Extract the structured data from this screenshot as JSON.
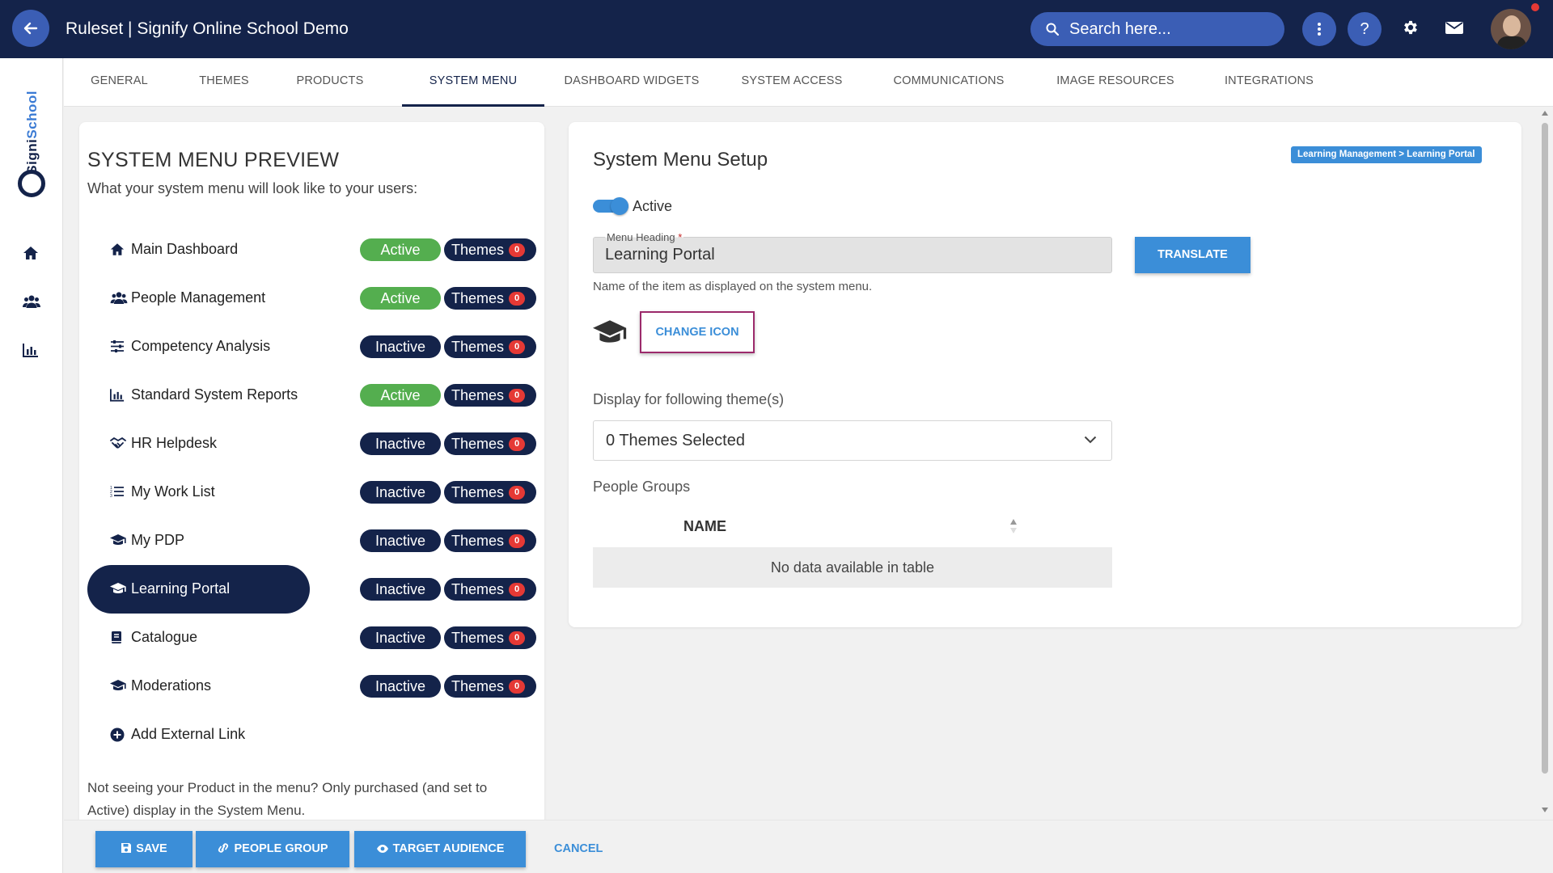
{
  "header": {
    "title": "Ruleset | Signify Online School Demo",
    "search_placeholder": "Search here..."
  },
  "rail": {
    "logo_part1": "Signi",
    "logo_part2": "School"
  },
  "tabs": [
    {
      "label": "GENERAL"
    },
    {
      "label": "THEMES"
    },
    {
      "label": "PRODUCTS"
    },
    {
      "label": "SYSTEM MENU",
      "active": true
    },
    {
      "label": "DASHBOARD WIDGETS"
    },
    {
      "label": "SYSTEM ACCESS"
    },
    {
      "label": "COMMUNICATIONS"
    },
    {
      "label": "IMAGE RESOURCES"
    },
    {
      "label": "INTEGRATIONS"
    }
  ],
  "preview": {
    "title": "SYSTEM MENU PREVIEW",
    "subtitle": "What your system menu will look like to your users:",
    "items": [
      {
        "label": "Main Dashboard",
        "icon": "home-icon",
        "status": "Active",
        "themes_label": "Themes",
        "themes_count": "0"
      },
      {
        "label": "People Management",
        "icon": "users-icon",
        "status": "Active",
        "themes_label": "Themes",
        "themes_count": "0"
      },
      {
        "label": "Competency Analysis",
        "icon": "sliders-icon",
        "status": "Inactive",
        "themes_label": "Themes",
        "themes_count": "0"
      },
      {
        "label": "Standard System Reports",
        "icon": "bar-chart-icon",
        "status": "Active",
        "themes_label": "Themes",
        "themes_count": "0"
      },
      {
        "label": "HR Helpdesk",
        "icon": "handshake-icon",
        "status": "Inactive",
        "themes_label": "Themes",
        "themes_count": "0"
      },
      {
        "label": "My Work List",
        "icon": "list-icon",
        "status": "Inactive",
        "themes_label": "Themes",
        "themes_count": "0"
      },
      {
        "label": "My PDP",
        "icon": "graduation-cap-icon",
        "status": "Inactive",
        "themes_label": "Themes",
        "themes_count": "0"
      },
      {
        "label": "Learning Portal",
        "icon": "graduation-cap-icon",
        "status": "Inactive",
        "themes_label": "Themes",
        "themes_count": "0",
        "selected": true
      },
      {
        "label": "Catalogue",
        "icon": "book-icon",
        "status": "Inactive",
        "themes_label": "Themes",
        "themes_count": "0"
      },
      {
        "label": "Moderations",
        "icon": "graduation-cap-icon",
        "status": "Inactive",
        "themes_label": "Themes",
        "themes_count": "0"
      }
    ],
    "add_link": "Add External Link",
    "footer_note": "Not seeing your Product in the menu? Only purchased (and set to Active) display in the System Menu."
  },
  "setup": {
    "title": "System Menu Setup",
    "breadcrumb": "Learning Management > Learning Portal",
    "active_label": "Active",
    "heading_label": "Menu Heading",
    "heading_required": "*",
    "heading_value": "Learning Portal",
    "translate_label": "TRANSLATE",
    "heading_hint": "Name of the item as displayed on the system menu.",
    "change_icon_label": "CHANGE ICON",
    "themes_section_label": "Display for following theme(s)",
    "themes_selected": "0 Themes Selected",
    "people_groups_label": "People Groups",
    "table_header_name": "NAME",
    "table_empty": "No data available in table"
  },
  "actions": {
    "save": "SAVE",
    "people_group": "PEOPLE GROUP",
    "target_audience": "TARGET AUDIENCE",
    "cancel": "CANCEL"
  },
  "colors": {
    "navy": "#14234a",
    "accent_blue": "#3b8ed8",
    "active_green": "#54ae4f",
    "badge_red": "#e53935",
    "highlight_border": "#9c2a6b"
  }
}
